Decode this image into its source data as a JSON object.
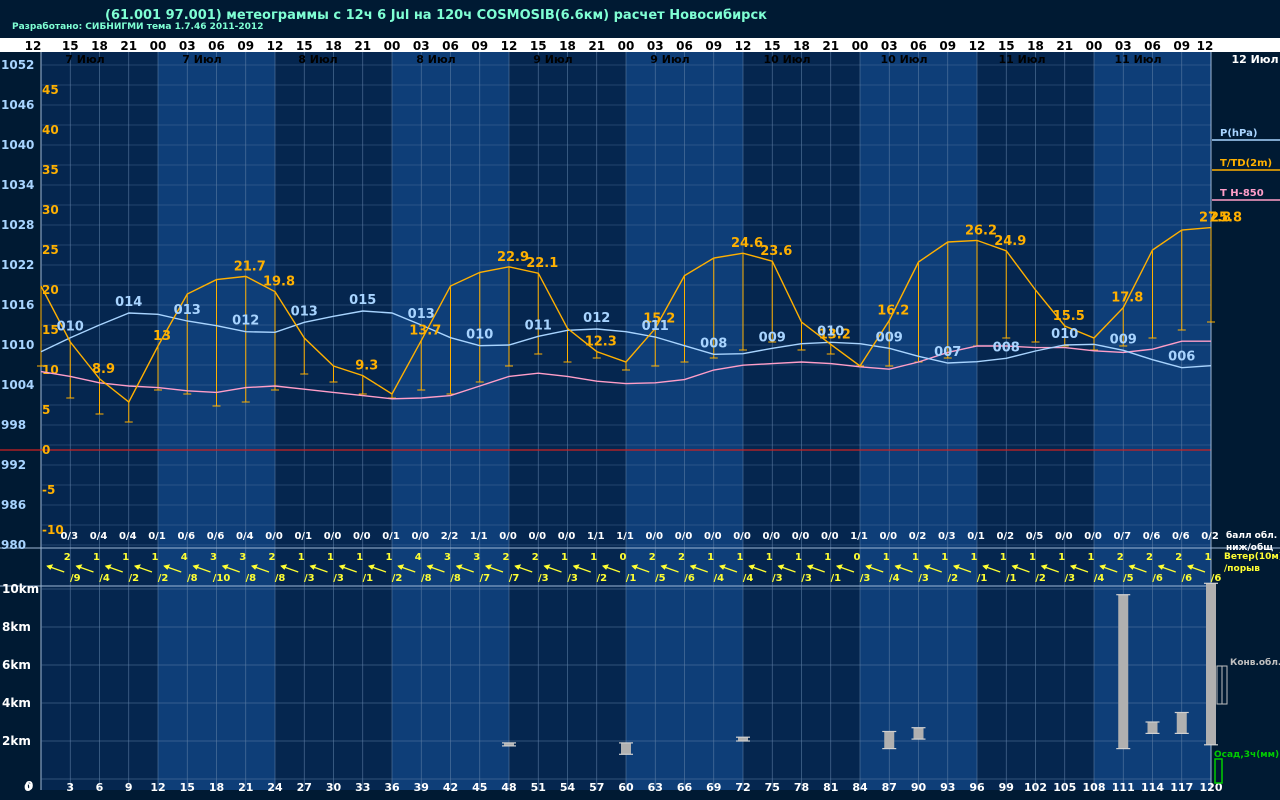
{
  "header": {
    "title": "(61.001 97.001) метеограммы с  12ч 6 Jul на 120ч COSMOSIB(6.6км) расчет Новосибирск",
    "subtitle": "Разработано: СИБНИГМИ тема 1.7.46 2011-2012"
  },
  "legend": {
    "pressure": "P(hPa)",
    "temp": "T/TD(2m)",
    "t850": "T H-850",
    "cloud": "балл обл.",
    "cloud2": "ниж/общ",
    "wind": "Ветер(10м)",
    "wind2": "/порыв",
    "conv": "Конв.обл.",
    "precip": "Осад,3ч(мм)"
  },
  "colors": {
    "background": "#001a33",
    "band_light": "#0e3e78",
    "band_dark": "#05264f",
    "pressure": "#a8d4ff",
    "temp": "#ffb000",
    "t850": "#ff9ec8",
    "wind": "#ffff33",
    "precip": "#00cc00",
    "cloud_bars": "#b0b0b0",
    "zero_line": "#cc2222"
  },
  "chart_data": {
    "type": "line",
    "hour_labels": [
      "12",
      "15",
      "18",
      "21",
      "00",
      "03",
      "06",
      "09",
      "12",
      "15",
      "18",
      "21",
      "00",
      "03",
      "06",
      "09",
      "12",
      "15",
      "18",
      "21",
      "00",
      "03",
      "06",
      "09",
      "12",
      "15",
      "18",
      "21",
      "00",
      "03",
      "06",
      "09",
      "12",
      "15",
      "18",
      "21",
      "00",
      "03",
      "06",
      "09",
      "12"
    ],
    "day_labels": [
      "7 Июл",
      "7 Июл",
      "8 Июл",
      "8 Июл",
      "9 Июл",
      "9 Июл",
      "10 Июл",
      "10 Июл",
      "11 Июл",
      "11 Июл",
      "12 Июл"
    ],
    "forecast_hours": [
      "0",
      "3",
      "6",
      "9",
      "12",
      "15",
      "18",
      "21",
      "24",
      "27",
      "30",
      "33",
      "36",
      "39",
      "42",
      "45",
      "48",
      "51",
      "54",
      "57",
      "60",
      "63",
      "66",
      "69",
      "72",
      "75",
      "78",
      "81",
      "84",
      "87",
      "90",
      "93",
      "96",
      "99",
      "102",
      "105",
      "108",
      "111",
      "114",
      "117",
      "120"
    ],
    "pressure_axis": {
      "ticks": [
        "1052",
        "1046",
        "1040",
        "1034",
        "1028",
        "1022",
        "1016",
        "1010",
        "1004",
        "998",
        "992",
        "986",
        "980"
      ],
      "range": [
        980,
        1054
      ]
    },
    "temp_axis": {
      "ticks": [
        "45",
        "40",
        "35",
        "30",
        "25",
        "20",
        "15",
        "10",
        "5",
        "0",
        "-5",
        "-10"
      ],
      "range": [
        -13,
        48
      ]
    },
    "height_axis": {
      "ticks": [
        "0",
        "2km",
        "4km",
        "6km",
        "8km",
        "10km"
      ]
    },
    "series": [
      {
        "name": "P(hPa)",
        "values": [
          1009.0,
          1011.1,
          1013.0,
          1014.8,
          1014.6,
          1013.6,
          1012.9,
          1012.0,
          1011.9,
          1013.4,
          1014.3,
          1015.1,
          1014.8,
          1013.0,
          1011.1,
          1009.9,
          1010.0,
          1011.3,
          1012.2,
          1012.4,
          1012.0,
          1011.2,
          1009.9,
          1008.6,
          1008.7,
          1009.5,
          1010.2,
          1010.4,
          1010.2,
          1009.5,
          1008.3,
          1007.3,
          1007.5,
          1008.0,
          1009.1,
          1010.0,
          1010.1,
          1009.2,
          1007.8,
          1006.6,
          1006.9
        ]
      },
      {
        "name": "T/TD(2m)",
        "values": [
          20.5,
          13.5,
          8.9,
          6.0,
          13.0,
          19.5,
          21.3,
          21.7,
          19.8,
          14.0,
          10.5,
          9.3,
          7.0,
          13.7,
          20.5,
          22.2,
          22.9,
          22.1,
          15.2,
          12.3,
          11.0,
          15.2,
          21.8,
          24.0,
          24.6,
          23.6,
          16.0,
          13.2,
          10.5,
          16.2,
          23.5,
          26.0,
          26.2,
          24.9,
          20.0,
          15.5,
          14.0,
          17.8,
          25.0,
          27.5,
          27.8
        ]
      },
      {
        "name": "TD(2m)",
        "values": [
          10.5,
          6.5,
          4.5,
          3.5,
          7.5,
          7.0,
          5.5,
          6.0,
          7.5,
          9.5,
          8.5,
          7.0,
          6.5,
          7.5,
          7.0,
          8.5,
          10.5,
          12.0,
          11.0,
          11.5,
          10.0,
          10.5,
          11.0,
          11.5,
          12.5,
          13.5,
          12.5,
          12.0,
          10.5,
          10.5,
          11.0,
          11.5,
          13.0,
          14.0,
          13.5,
          13.0,
          12.5,
          13.0,
          14.0,
          15.0,
          16.0
        ]
      },
      {
        "name": "T H-850",
        "values": [
          9.8,
          9.2,
          8.4,
          8.0,
          7.8,
          7.4,
          7.2,
          7.8,
          8.0,
          7.6,
          7.2,
          6.8,
          6.4,
          6.5,
          6.8,
          8.0,
          9.2,
          9.6,
          9.2,
          8.6,
          8.3,
          8.4,
          8.8,
          10.0,
          10.6,
          10.8,
          11.0,
          10.8,
          10.4,
          10.1,
          11.0,
          12.2,
          13.0,
          13.0,
          12.8,
          12.8,
          12.4,
          12.2,
          12.6,
          13.6,
          13.6
        ]
      }
    ],
    "temp_labels": [
      {
        "i": 2,
        "text": "8.9"
      },
      {
        "i": 4,
        "text": "13"
      },
      {
        "i": 7,
        "text": "21.7"
      },
      {
        "i": 8,
        "text": "19.8"
      },
      {
        "i": 11,
        "text": "9.3"
      },
      {
        "i": 13,
        "text": "13.7"
      },
      {
        "i": 16,
        "text": "22.9"
      },
      {
        "i": 17,
        "text": "22.1"
      },
      {
        "i": 19,
        "text": "12.3"
      },
      {
        "i": 21,
        "text": "15.2"
      },
      {
        "i": 24,
        "text": "24.6"
      },
      {
        "i": 25,
        "text": "23.6"
      },
      {
        "i": 27,
        "text": "13.2"
      },
      {
        "i": 29,
        "text": "16.2"
      },
      {
        "i": 32,
        "text": "26.2"
      },
      {
        "i": 33,
        "text": "24.9"
      },
      {
        "i": 35,
        "text": "15.5"
      },
      {
        "i": 37,
        "text": "17.8"
      },
      {
        "i": 40,
        "text": "27.8"
      },
      {
        "i": 41,
        "text": "25.8"
      }
    ],
    "pressure_labels": [
      {
        "i": 1,
        "text": "010"
      },
      {
        "i": 3,
        "text": "014"
      },
      {
        "i": 5,
        "text": "013"
      },
      {
        "i": 7,
        "text": "012"
      },
      {
        "i": 9,
        "text": "013"
      },
      {
        "i": 11,
        "text": "015"
      },
      {
        "i": 13,
        "text": "013"
      },
      {
        "i": 15,
        "text": "010"
      },
      {
        "i": 17,
        "text": "011"
      },
      {
        "i": 19,
        "text": "012"
      },
      {
        "i": 21,
        "text": "011"
      },
      {
        "i": 23,
        "text": "008"
      },
      {
        "i": 25,
        "text": "009"
      },
      {
        "i": 27,
        "text": "010"
      },
      {
        "i": 29,
        "text": "009"
      },
      {
        "i": 31,
        "text": "007"
      },
      {
        "i": 33,
        "text": "008"
      },
      {
        "i": 35,
        "text": "010"
      },
      {
        "i": 37,
        "text": "009"
      },
      {
        "i": 39,
        "text": "006"
      }
    ],
    "cloud": [
      "0/3",
      "0/4",
      "0/4",
      "0/1",
      "0/6",
      "0/6",
      "0/4",
      "0/0",
      "0/1",
      "0/0",
      "0/0",
      "0/1",
      "0/0",
      "2/2",
      "1/1",
      "0/0",
      "0/0",
      "0/0",
      "1/1",
      "1/1",
      "0/0",
      "0/0",
      "0/0",
      "0/0",
      "0/0",
      "0/0",
      "0/0",
      "1/1",
      "0/0",
      "0/2",
      "0/3",
      "0/1",
      "0/2",
      "0/5",
      "0/0",
      "0/0",
      "0/7",
      "0/6",
      "0/6",
      "0/2"
    ],
    "wind_speed": [
      "2",
      "1",
      "1",
      "1",
      "4",
      "3",
      "3",
      "2",
      "1",
      "1",
      "1",
      "1",
      "4",
      "3",
      "3",
      "2",
      "2",
      "1",
      "1",
      "0",
      "2",
      "2",
      "1",
      "1",
      "1",
      "1",
      "1",
      "0",
      "1",
      "1",
      "1",
      "1",
      "1",
      "1",
      "1",
      "1",
      "2",
      "2",
      "2",
      "1"
    ],
    "wind_gust": [
      "/9",
      "/4",
      "/2",
      "/2",
      "/8",
      "/10",
      "/8",
      "/8",
      "/3",
      "/3",
      "/1",
      "/2",
      "/8",
      "/8",
      "/7",
      "/7",
      "/3",
      "/3",
      "/2",
      "/1",
      "/5",
      "/6",
      "/4",
      "/4",
      "/3",
      "/3",
      "/1",
      "/3",
      "/4",
      "/3",
      "/2",
      "/1",
      "/1",
      "/2",
      "/3",
      "/4",
      "/5",
      "/6",
      "/6",
      "/6"
    ],
    "conv_clouds": [
      {
        "i": 16,
        "bottom": 1.8,
        "top": 1.9
      },
      {
        "i": 20,
        "bottom": 1.3,
        "top": 1.9
      },
      {
        "i": 24,
        "bottom": 2.0,
        "top": 2.2
      },
      {
        "i": 29,
        "bottom": 1.6,
        "top": 2.5
      },
      {
        "i": 30,
        "bottom": 2.1,
        "top": 2.7
      },
      {
        "i": 37,
        "bottom": 1.6,
        "top": 9.7
      },
      {
        "i": 38,
        "bottom": 2.4,
        "top": 3.0
      },
      {
        "i": 39,
        "bottom": 2.4,
        "top": 3.5
      },
      {
        "i": 40,
        "bottom": 1.8,
        "top": 10.3
      }
    ]
  }
}
